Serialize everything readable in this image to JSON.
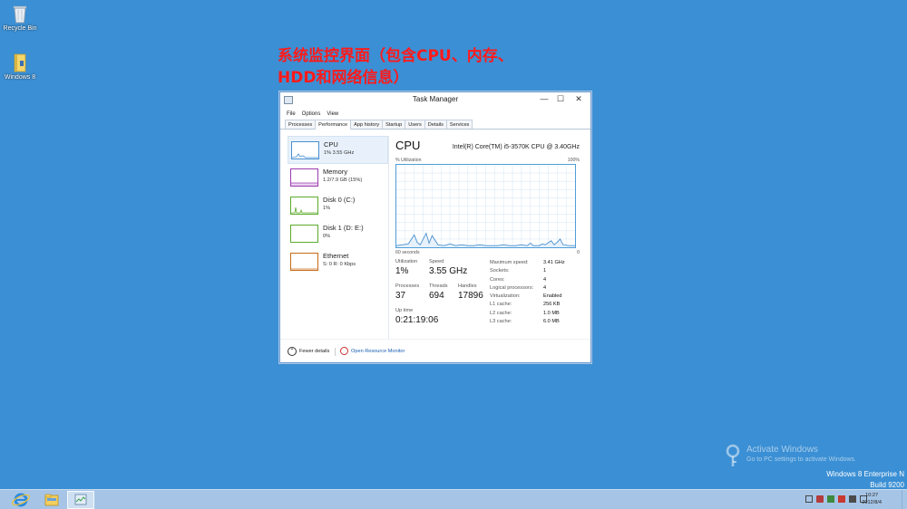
{
  "desktop": {
    "icons": [
      {
        "label": "Recycle Bin"
      },
      {
        "label": "Windows 8"
      }
    ],
    "caption_line1": "系统监控界面（包含CPU、内存、",
    "caption_line2": "HDD和网络信息）"
  },
  "window": {
    "title": "Task Manager",
    "controls": {
      "minimize": "—",
      "maximize": "☐",
      "close": "✕"
    },
    "menu": [
      "File",
      "Options",
      "View"
    ],
    "tabs": [
      {
        "label": "Processes",
        "active": false
      },
      {
        "label": "Performance",
        "active": true
      },
      {
        "label": "App history",
        "active": false
      },
      {
        "label": "Startup",
        "active": false
      },
      {
        "label": "Users",
        "active": false
      },
      {
        "label": "Details",
        "active": false
      },
      {
        "label": "Services",
        "active": false
      }
    ],
    "resources": [
      {
        "name": "CPU",
        "sub": "1% 3.55 GHz",
        "color": "#4a90d0",
        "active": true
      },
      {
        "name": "Memory",
        "sub": "1.2/7.9 GB (15%)",
        "color": "#9b3bb0",
        "active": false
      },
      {
        "name": "Disk 0 (C:)",
        "sub": "1%",
        "color": "#5cab2c",
        "active": false
      },
      {
        "name": "Disk 1 (D: E:)",
        "sub": "0%",
        "color": "#5cab2c",
        "active": false
      },
      {
        "name": "Ethernet",
        "sub": "S: 0 R: 0 Kbps",
        "color": "#c66a18",
        "active": false
      }
    ],
    "detail": {
      "title": "CPU",
      "model": "Intel(R) Core(TM) i5-3570K CPU @ 3.40GHz",
      "util_label": "% Utilization",
      "util_max": "100%",
      "axis_left": "60 seconds",
      "axis_right": "0",
      "stats": {
        "utilization": {
          "label": "Utilization",
          "value": "1%"
        },
        "speed": {
          "label": "Speed",
          "value": "3.55 GHz"
        },
        "processes": {
          "label": "Processes",
          "value": "37"
        },
        "threads": {
          "label": "Threads",
          "value": "694"
        },
        "handles": {
          "label": "Handles",
          "value": "17896"
        },
        "uptime": {
          "label": "Up time",
          "value": "0:21:19:06"
        }
      },
      "specs": [
        {
          "k": "Maximum speed:",
          "v": "3.41 GHz"
        },
        {
          "k": "Sockets:",
          "v": "1"
        },
        {
          "k": "Cores:",
          "v": "4"
        },
        {
          "k": "Logical processors:",
          "v": "4"
        },
        {
          "k": "Virtualization:",
          "v": "Enabled"
        },
        {
          "k": "L1 cache:",
          "v": "256 KB"
        },
        {
          "k": "L2 cache:",
          "v": "1.0 MB"
        },
        {
          "k": "L3 cache:",
          "v": "6.0 MB"
        }
      ]
    },
    "footer": {
      "fewer_details": "Fewer details",
      "open_resource_monitor": "Open Resource Monitor"
    }
  },
  "chart_data": {
    "type": "line",
    "title": "",
    "xlabel": "60 seconds",
    "ylabel": "% Utilization",
    "xlim": [
      60,
      0
    ],
    "ylim": [
      0,
      100
    ],
    "grid": true,
    "x": [
      60,
      58,
      56,
      54,
      53,
      52,
      50,
      49,
      48,
      46,
      44,
      42,
      40,
      38,
      36,
      34,
      32,
      30,
      28,
      26,
      24,
      22,
      20,
      18,
      16,
      15,
      14,
      12,
      11,
      10,
      8,
      7,
      6,
      5,
      4,
      2,
      0
    ],
    "series": [
      {
        "values": [
          2,
          3,
          4,
          15,
          6,
          3,
          17,
          5,
          14,
          3,
          2,
          4,
          2,
          3,
          2,
          2,
          3,
          2,
          2,
          2,
          3,
          2,
          2,
          3,
          2,
          5,
          2,
          2,
          4,
          3,
          8,
          3,
          6,
          10,
          3,
          2,
          2
        ]
      }
    ]
  },
  "watermark": {
    "title": "Activate Windows",
    "subtitle": "Go to PC settings to activate Windows."
  },
  "edition": {
    "line1": "Windows 8 Enterprise N",
    "line2": "Build 9200"
  },
  "taskbar": {
    "apps": [
      {
        "name": "ie-icon"
      },
      {
        "name": "explorer-icon"
      },
      {
        "name": "task-manager-icon"
      }
    ],
    "time": "10:27",
    "date": "2012/8/4"
  }
}
